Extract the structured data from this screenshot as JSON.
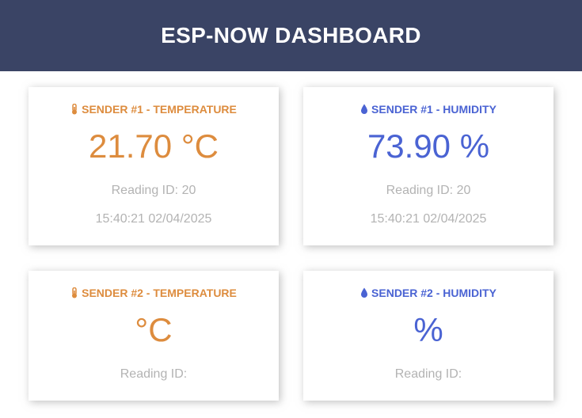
{
  "header": {
    "title": "ESP-NOW DASHBOARD"
  },
  "colors": {
    "header_bg": "#3a4465",
    "temperature_accent": "#dd8c3e",
    "humidity_accent": "#4a63d3",
    "muted_text": "#b3b3b3"
  },
  "cards": [
    {
      "icon": "thermometer-icon",
      "title": "SENDER #1 - TEMPERATURE",
      "value": "21.70 °C",
      "reading_id": "Reading ID: 20",
      "timestamp": "15:40:21 02/04/2025"
    },
    {
      "icon": "water-drop-icon",
      "title": "SENDER #1 - HUMIDITY",
      "value": "73.90 %",
      "reading_id": "Reading ID: 20",
      "timestamp": "15:40:21 02/04/2025"
    },
    {
      "icon": "thermometer-icon",
      "title": "SENDER #2 - TEMPERATURE",
      "value": "°C",
      "reading_id": "Reading ID:"
    },
    {
      "icon": "water-drop-icon",
      "title": "SENDER #2 - HUMIDITY",
      "value": "%",
      "reading_id": "Reading ID:"
    }
  ]
}
